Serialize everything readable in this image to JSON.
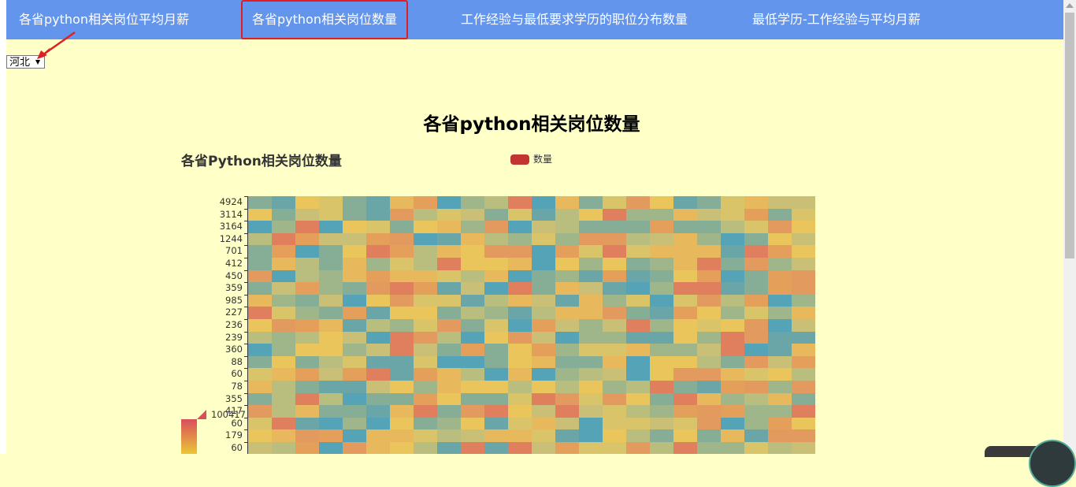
{
  "nav": {
    "items": [
      {
        "label": "各省python相关岗位平均月薪",
        "active": false
      },
      {
        "label": "各省python相关岗位数量",
        "active": true
      },
      {
        "label": "工作经验与最低要求学历的职位分布数量",
        "active": false
      },
      {
        "label": "最低学历-工作经验与平均月薪",
        "active": false
      }
    ]
  },
  "province_select": {
    "value": "河北"
  },
  "page": {
    "title": "各省python相关岗位数量"
  },
  "colors": {
    "nav_bg": "#6495ed",
    "page_bg": "#ffffc8",
    "highlight": "#e02020",
    "legend": "#c23531"
  },
  "chart_data": {
    "type": "heatmap",
    "title": "各省Python相关岗位数量",
    "legend": [
      "数量"
    ],
    "y_categories": [
      "4924",
      "3114",
      "3164",
      "1244",
      "701",
      "412",
      "450",
      "359",
      "985",
      "227",
      "236",
      "239",
      "360",
      "88",
      "60",
      "78",
      "355",
      "417",
      "60",
      "179",
      "60"
    ],
    "visual_map": {
      "max_label": "100417"
    },
    "grid": false,
    "legend_position": "top-center"
  }
}
